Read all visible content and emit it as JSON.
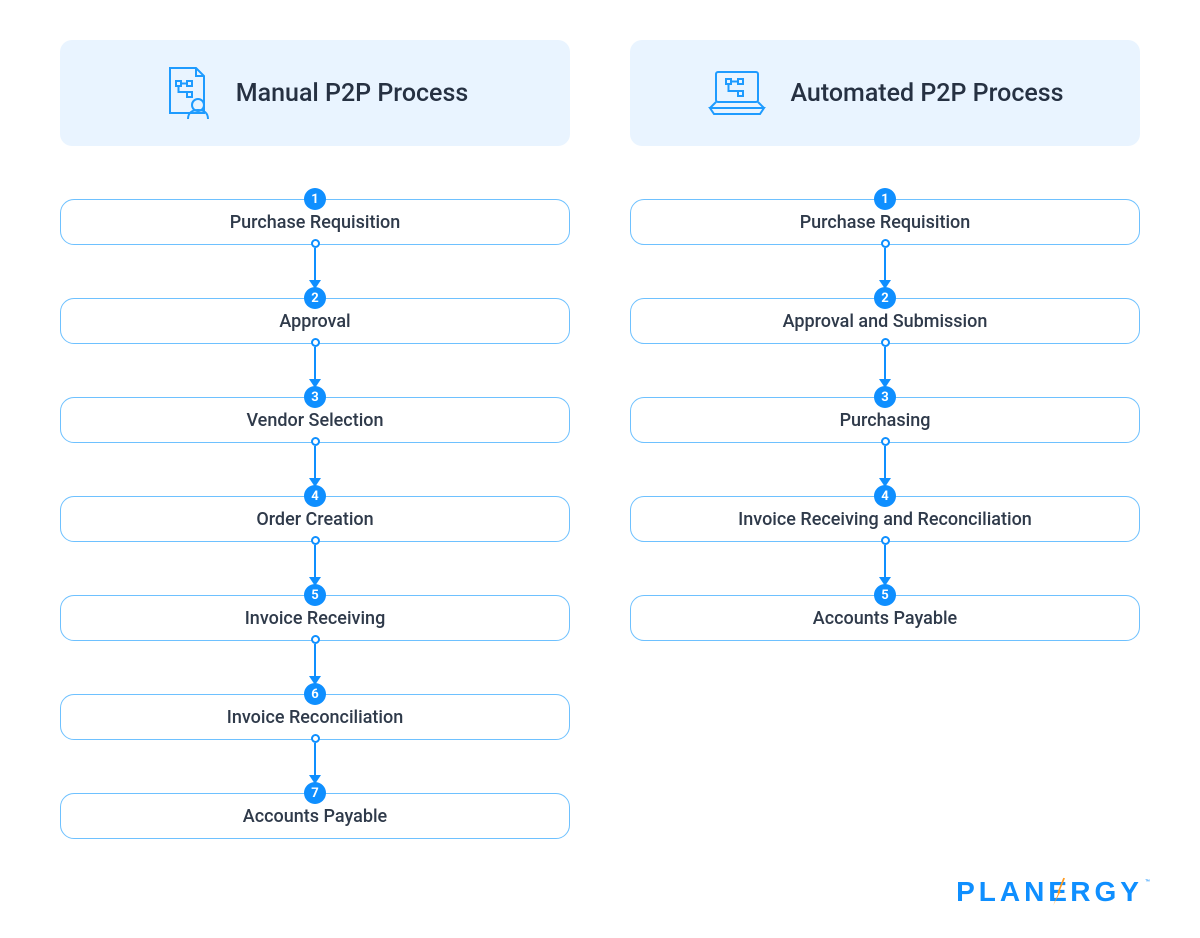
{
  "brand": {
    "name": "PLANERGY",
    "tm": "™"
  },
  "colors": {
    "accent": "#1e9bff",
    "panel": "#e9f4ff",
    "text": "#2f3a4a"
  },
  "columns": [
    {
      "id": "manual",
      "title": "Manual P2P Process",
      "icon": "document-user-icon",
      "steps": [
        "Purchase Requisition",
        "Approval",
        "Vendor Selection",
        "Order Creation",
        "Invoice Receiving",
        "Invoice Reconciliation",
        "Accounts Payable"
      ]
    },
    {
      "id": "automated",
      "title": "Automated P2P Process",
      "icon": "laptop-process-icon",
      "steps": [
        "Purchase Requisition",
        "Approval and Submission",
        "Purchasing",
        "Invoice Receiving and Reconciliation",
        "Accounts Payable"
      ]
    }
  ]
}
